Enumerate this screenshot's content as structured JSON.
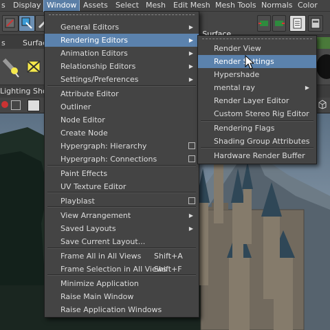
{
  "menubar": {
    "items": [
      "s",
      "Display",
      "Window",
      "Assets",
      "Select",
      "Mesh",
      "Edit Mesh",
      "Mesh Tools",
      "Normals",
      "Color"
    ]
  },
  "toolbar": {
    "live_surface_label": "e Surface"
  },
  "shelf": {
    "tab_left": "s",
    "tab_right": "Surfac"
  },
  "panel_menus": {
    "lighting": "Lighting",
    "show": "Sho"
  },
  "window_menu": {
    "items": [
      {
        "label": "General Editors",
        "submenu": true
      },
      {
        "label": "Rendering Editors",
        "submenu": true,
        "highlighted": true
      },
      {
        "label": "Animation Editors",
        "submenu": true
      },
      {
        "label": "Relationship Editors",
        "submenu": true
      },
      {
        "label": "Settings/Preferences",
        "submenu": true
      },
      {
        "label": "Attribute Editor"
      },
      {
        "label": "Outliner"
      },
      {
        "label": "Node Editor"
      },
      {
        "label": "Create Node"
      },
      {
        "label": "Hypergraph: Hierarchy",
        "option": true
      },
      {
        "label": "Hypergraph: Connections",
        "option": true
      },
      {
        "label": "Paint Effects"
      },
      {
        "label": "UV Texture Editor"
      },
      {
        "label": "Playblast",
        "option": true
      },
      {
        "label": "View Arrangement",
        "submenu": true
      },
      {
        "label": "Saved Layouts",
        "submenu": true
      },
      {
        "label": "Save Current Layout..."
      },
      {
        "label": "Frame All in All Views",
        "shortcut": "Shift+A"
      },
      {
        "label": "Frame Selection in All Views",
        "shortcut": "Shift+F"
      },
      {
        "label": "Minimize Application"
      },
      {
        "label": "Raise Main Window"
      },
      {
        "label": "Raise Application Windows"
      }
    ]
  },
  "rendering_menu": {
    "items": [
      {
        "label": "Render View"
      },
      {
        "label": "Render Settings",
        "highlighted": true
      },
      {
        "label": "Hypershade"
      },
      {
        "label": "mental ray",
        "submenu": true
      },
      {
        "label": "Render Layer Editor"
      },
      {
        "label": "Custom Stereo Rig Editor"
      },
      {
        "label": "Rendering Flags"
      },
      {
        "label": "Shading Group Attributes"
      },
      {
        "label": "Hardware Render Buffer"
      }
    ]
  },
  "colors": {
    "menu_bg": "#444444",
    "highlight": "#5b82ad",
    "menubar_active": "#5a7ea6"
  }
}
